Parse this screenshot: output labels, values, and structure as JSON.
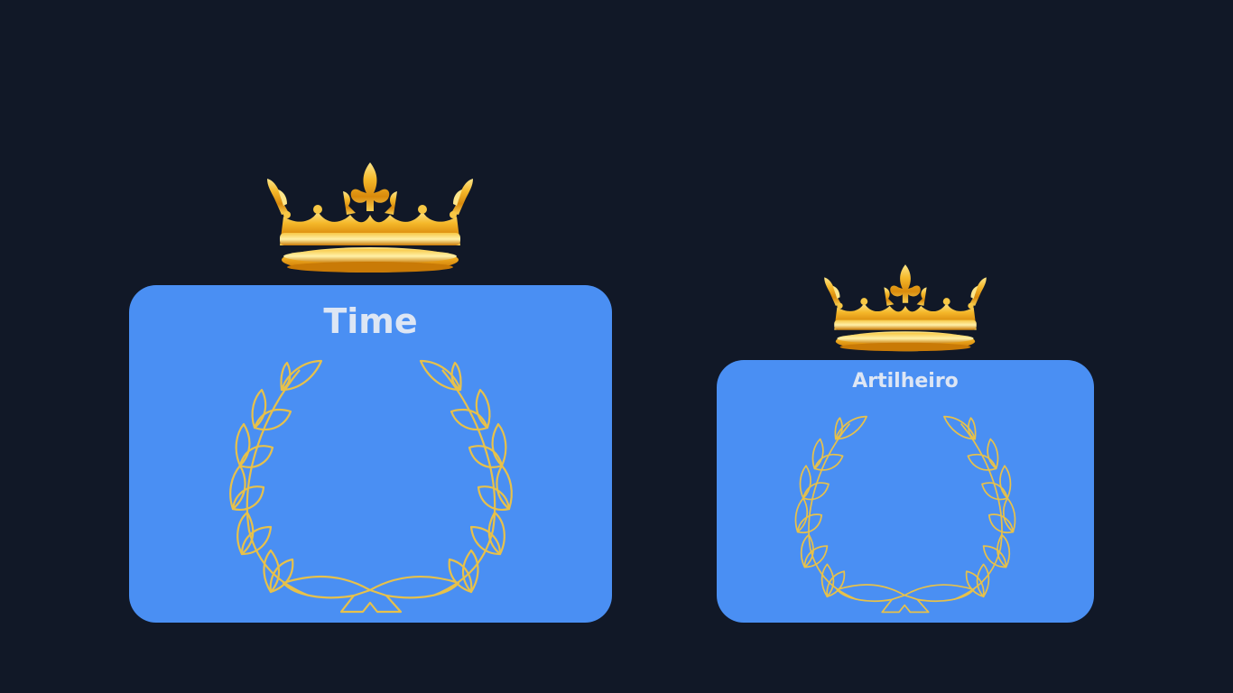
{
  "cards": {
    "time": {
      "title": "Time",
      "icon": "crown-icon",
      "emblem": "laurel-wreath-icon"
    },
    "artilheiro": {
      "title": "Artilheiro",
      "icon": "crown-icon",
      "emblem": "laurel-wreath-icon"
    }
  },
  "colors": {
    "background": "#111827",
    "card": "#4a8ff3",
    "card_title": "#dde6f4",
    "wreath": "#e7c14a",
    "crown_gold": "#f2b12a"
  }
}
